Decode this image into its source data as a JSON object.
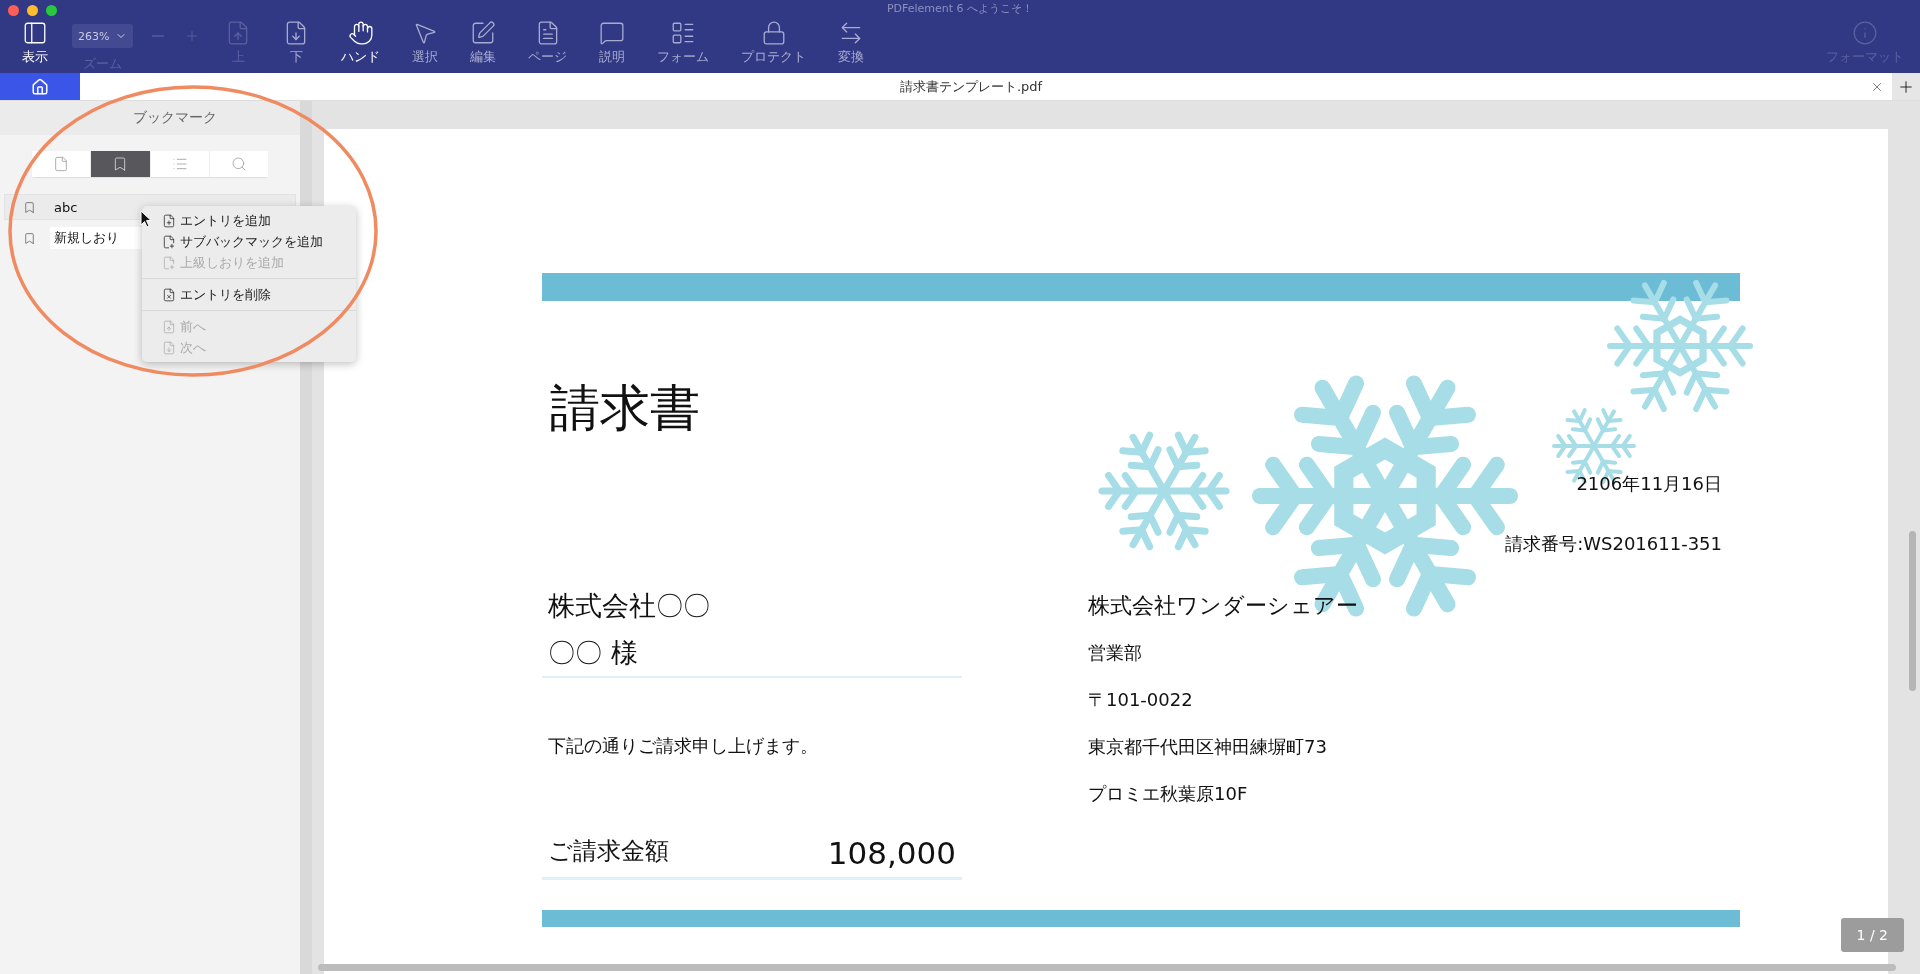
{
  "window": {
    "title": "PDFelement 6 へようこそ！"
  },
  "toolbar": {
    "items": [
      {
        "kind": "view",
        "label": "表示",
        "active": true,
        "disabled": false
      },
      {
        "kind": "zoom",
        "label": "ズーム",
        "value": "263%",
        "active": false,
        "disabled": true
      },
      {
        "kind": "zoom-out",
        "active": false,
        "disabled": true
      },
      {
        "kind": "zoom-in",
        "active": false,
        "disabled": true
      },
      {
        "kind": "up",
        "label": "上",
        "active": false,
        "disabled": true
      },
      {
        "kind": "down",
        "label": "下",
        "active": false,
        "disabled": false
      },
      {
        "kind": "hand",
        "label": "ハンド",
        "active": true,
        "disabled": false
      },
      {
        "kind": "select",
        "label": "選択",
        "active": false,
        "disabled": false
      },
      {
        "kind": "edit",
        "label": "編集",
        "active": false,
        "disabled": false
      },
      {
        "kind": "page",
        "label": "ページ",
        "active": false,
        "disabled": false
      },
      {
        "kind": "comment",
        "label": "説明",
        "active": false,
        "disabled": false
      },
      {
        "kind": "form",
        "label": "フォーム",
        "active": false,
        "disabled": false
      },
      {
        "kind": "protect",
        "label": "プロテクト",
        "active": false,
        "disabled": false
      },
      {
        "kind": "convert",
        "label": "変換",
        "active": false,
        "disabled": false
      }
    ],
    "right_items": [
      {
        "kind": "format",
        "label": "フォーマット",
        "active": false,
        "disabled": true
      }
    ]
  },
  "tab": {
    "title": "請求書テンプレート.pdf"
  },
  "sidebar": {
    "title": "ブックマーク",
    "tabs": [
      {
        "kind": "pages",
        "selected": false
      },
      {
        "kind": "bookmarks",
        "selected": true
      },
      {
        "kind": "outline",
        "selected": false
      },
      {
        "kind": "search",
        "selected": false
      }
    ],
    "bookmarks": [
      {
        "label": "abc",
        "selected": true
      },
      {
        "label": "新規しおり",
        "selected": false
      }
    ]
  },
  "context_menu": {
    "groups": [
      [
        {
          "kind": "add",
          "label": "エントリを追加",
          "disabled": false
        },
        {
          "kind": "add-sub",
          "label": "サブバックマックを追加",
          "disabled": false
        },
        {
          "kind": "add-parent",
          "label": "上級しおりを追加",
          "disabled": true
        }
      ],
      [
        {
          "kind": "delete",
          "label": "エントリを削除",
          "disabled": false
        }
      ],
      [
        {
          "kind": "prev",
          "label": "前へ",
          "disabled": true
        },
        {
          "kind": "next",
          "label": "次へ",
          "disabled": true
        }
      ]
    ]
  },
  "document": {
    "title": "請求書",
    "date": "2106年11月16日",
    "invoice_number": "請求番号:WS201611-351",
    "recipient": [
      "株式会社〇〇",
      "〇〇 様"
    ],
    "message": "下記の通りご請求申し上げます。",
    "amount_label": "ご請求金額",
    "amount": "108,000",
    "sender": [
      "株式会社ワンダーシェアー",
      "営業部",
      "〒101-0022",
      "東京都千代田区神田練塀町73",
      "プロミエ秋葉原10F"
    ]
  },
  "page_indicator": "1 / 2"
}
